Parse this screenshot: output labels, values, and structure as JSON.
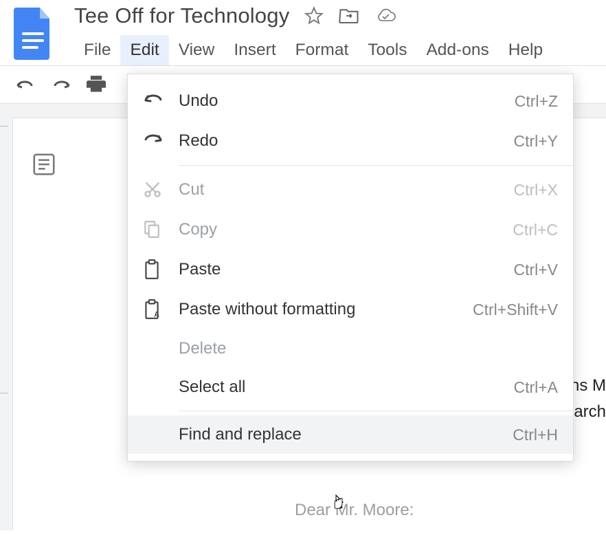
{
  "doc": {
    "title": "Tee Off for Technology"
  },
  "menubar": {
    "items": [
      "File",
      "Edit",
      "View",
      "Insert",
      "Format",
      "Tools",
      "Add-ons",
      "Help"
    ],
    "active_index": 1
  },
  "edit_menu": {
    "items": [
      {
        "icon": "undo",
        "label": "Undo",
        "shortcut": "Ctrl+Z",
        "disabled": false,
        "sep_after": false
      },
      {
        "icon": "redo",
        "label": "Redo",
        "shortcut": "Ctrl+Y",
        "disabled": false,
        "sep_after": true
      },
      {
        "icon": "cut",
        "label": "Cut",
        "shortcut": "Ctrl+X",
        "disabled": true,
        "sep_after": false
      },
      {
        "icon": "copy",
        "label": "Copy",
        "shortcut": "Ctrl+C",
        "disabled": true,
        "sep_after": false
      },
      {
        "icon": "paste",
        "label": "Paste",
        "shortcut": "Ctrl+V",
        "disabled": false,
        "sep_after": false
      },
      {
        "icon": "paste-plain",
        "label": "Paste without formatting",
        "shortcut": "Ctrl+Shift+V",
        "disabled": false,
        "sep_after": false
      },
      {
        "icon": "",
        "label": "Delete",
        "shortcut": "",
        "disabled": true,
        "sep_after": false
      },
      {
        "icon": "",
        "label": "Select all",
        "shortcut": "Ctrl+A",
        "disabled": false,
        "sep_after": true
      },
      {
        "icon": "",
        "label": "Find and replace",
        "shortcut": "Ctrl+H",
        "disabled": false,
        "sep_after": false,
        "hover": true
      }
    ]
  },
  "body": {
    "line1_fragment": "ns M",
    "line2_fragment": "arch",
    "greeting_fragment": "Dear Mr. Moore:"
  },
  "colors": {
    "brand_blue": "#4285f4"
  }
}
